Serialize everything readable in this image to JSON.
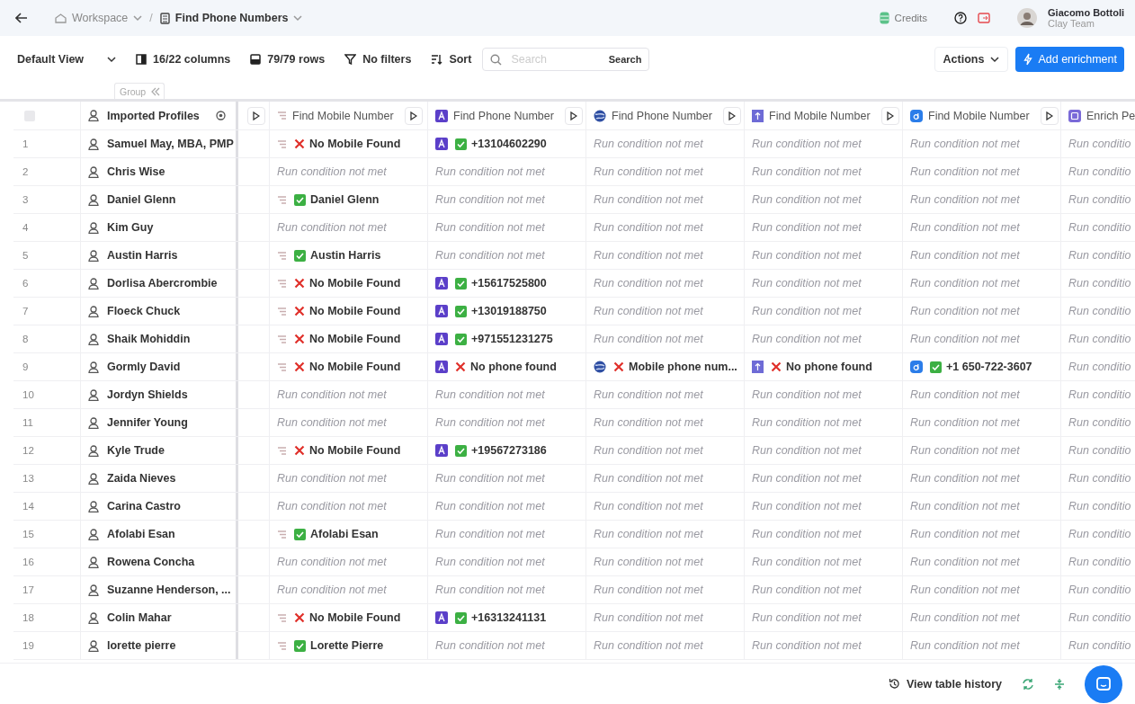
{
  "topbar": {
    "workspace": "Workspace",
    "separator": "/",
    "table_name": "Find Phone Numbers",
    "credits": "Credits",
    "user_name": "Giacomo Bottoli",
    "team": "Clay Team"
  },
  "toolbar": {
    "view": "Default View",
    "columns": "16/22 columns",
    "rows": "79/79 rows",
    "filters": "No filters",
    "sort": "Sort",
    "search": {
      "placeholder": "Search",
      "button": "Search"
    },
    "actions": "Actions",
    "add": "Add enrichment"
  },
  "group_tab": "Group",
  "table": {
    "select_all": {
      "checked": false
    },
    "profile_column": "Imported Profiles",
    "columns": [
      {
        "label": "Find Mobile Number"
      },
      {
        "label": "Find Phone Number"
      },
      {
        "label": "Find Phone Number"
      },
      {
        "label": "Find Mobile Number"
      },
      {
        "label": "Find Mobile Number"
      },
      {
        "label": "Enrich Pe"
      }
    ],
    "rows": [
      {
        "number": "1",
        "name": "Samuel May, MBA, PMP",
        "cells": [
          {
            "kind": "not_found",
            "text": "No Mobile Found"
          },
          {
            "kind": "found",
            "text": "+13104602290"
          },
          {
            "kind": "not_met",
            "text": "Run condition not met"
          },
          {
            "kind": "not_met",
            "text": "Run condition not met"
          },
          {
            "kind": "not_met",
            "text": "Run condition not met"
          },
          {
            "kind": "not_met",
            "text": "Run conditio"
          }
        ]
      },
      {
        "number": "2",
        "name": "Chris Wise",
        "cells": [
          {
            "kind": "not_met",
            "text": "Run condition not met"
          },
          {
            "kind": "not_met",
            "text": "Run condition not met"
          },
          {
            "kind": "not_met",
            "text": "Run condition not met"
          },
          {
            "kind": "not_met",
            "text": "Run condition not met"
          },
          {
            "kind": "not_met",
            "text": "Run condition not met"
          },
          {
            "kind": "not_met",
            "text": "Run conditio"
          }
        ]
      },
      {
        "number": "3",
        "name": "Daniel Glenn",
        "cells": [
          {
            "kind": "found",
            "text": "Daniel Glenn"
          },
          {
            "kind": "not_met",
            "text": "Run condition not met"
          },
          {
            "kind": "not_met",
            "text": "Run condition not met"
          },
          {
            "kind": "not_met",
            "text": "Run condition not met"
          },
          {
            "kind": "not_met",
            "text": "Run condition not met"
          },
          {
            "kind": "not_met",
            "text": "Run conditio"
          }
        ]
      },
      {
        "number": "4",
        "name": "Kim Guy",
        "cells": [
          {
            "kind": "not_met",
            "text": "Run condition not met"
          },
          {
            "kind": "not_met",
            "text": "Run condition not met"
          },
          {
            "kind": "not_met",
            "text": "Run condition not met"
          },
          {
            "kind": "not_met",
            "text": "Run condition not met"
          },
          {
            "kind": "not_met",
            "text": "Run condition not met"
          },
          {
            "kind": "not_met",
            "text": "Run conditio"
          }
        ]
      },
      {
        "number": "5",
        "name": "Austin Harris",
        "cells": [
          {
            "kind": "found",
            "text": "Austin Harris"
          },
          {
            "kind": "not_met",
            "text": "Run condition not met"
          },
          {
            "kind": "not_met",
            "text": "Run condition not met"
          },
          {
            "kind": "not_met",
            "text": "Run condition not met"
          },
          {
            "kind": "not_met",
            "text": "Run condition not met"
          },
          {
            "kind": "not_met",
            "text": "Run conditio"
          }
        ]
      },
      {
        "number": "6",
        "name": "Dorlisa Abercrombie",
        "cells": [
          {
            "kind": "not_found",
            "text": "No Mobile Found"
          },
          {
            "kind": "found",
            "text": "+15617525800"
          },
          {
            "kind": "not_met",
            "text": "Run condition not met"
          },
          {
            "kind": "not_met",
            "text": "Run condition not met"
          },
          {
            "kind": "not_met",
            "text": "Run condition not met"
          },
          {
            "kind": "not_met",
            "text": "Run conditio"
          }
        ]
      },
      {
        "number": "7",
        "name": "Floeck Chuck",
        "cells": [
          {
            "kind": "not_found",
            "text": "No Mobile Found"
          },
          {
            "kind": "found",
            "text": "+13019188750"
          },
          {
            "kind": "not_met",
            "text": "Run condition not met"
          },
          {
            "kind": "not_met",
            "text": "Run condition not met"
          },
          {
            "kind": "not_met",
            "text": "Run condition not met"
          },
          {
            "kind": "not_met",
            "text": "Run conditio"
          }
        ]
      },
      {
        "number": "8",
        "name": "Shaik Mohiddin",
        "cells": [
          {
            "kind": "not_found",
            "text": "No Mobile Found"
          },
          {
            "kind": "found",
            "text": "+971551231275"
          },
          {
            "kind": "not_met",
            "text": "Run condition not met"
          },
          {
            "kind": "not_met",
            "text": "Run condition not met"
          },
          {
            "kind": "not_met",
            "text": "Run condition not met"
          },
          {
            "kind": "not_met",
            "text": "Run conditio"
          }
        ]
      },
      {
        "number": "9",
        "name": "Gormly David",
        "cells": [
          {
            "kind": "not_found",
            "text": "No Mobile Found"
          },
          {
            "kind": "not_found",
            "text": "No phone found"
          },
          {
            "kind": "not_found",
            "text": "Mobile phone num..."
          },
          {
            "kind": "not_found",
            "text": "No phone found"
          },
          {
            "kind": "found",
            "text": "+1 650-722-3607"
          },
          {
            "kind": "not_met",
            "text": "Run conditio"
          }
        ]
      },
      {
        "number": "10",
        "name": "Jordyn Shields",
        "cells": [
          {
            "kind": "not_met",
            "text": "Run condition not met"
          },
          {
            "kind": "not_met",
            "text": "Run condition not met"
          },
          {
            "kind": "not_met",
            "text": "Run condition not met"
          },
          {
            "kind": "not_met",
            "text": "Run condition not met"
          },
          {
            "kind": "not_met",
            "text": "Run condition not met"
          },
          {
            "kind": "not_met",
            "text": "Run conditio"
          }
        ]
      },
      {
        "number": "11",
        "name": "Jennifer Young",
        "cells": [
          {
            "kind": "not_met",
            "text": "Run condition not met"
          },
          {
            "kind": "not_met",
            "text": "Run condition not met"
          },
          {
            "kind": "not_met",
            "text": "Run condition not met"
          },
          {
            "kind": "not_met",
            "text": "Run condition not met"
          },
          {
            "kind": "not_met",
            "text": "Run condition not met"
          },
          {
            "kind": "not_met",
            "text": "Run conditio"
          }
        ]
      },
      {
        "number": "12",
        "name": "Kyle Trude",
        "cells": [
          {
            "kind": "not_found",
            "text": "No Mobile Found"
          },
          {
            "kind": "found",
            "text": "+19567273186"
          },
          {
            "kind": "not_met",
            "text": "Run condition not met"
          },
          {
            "kind": "not_met",
            "text": "Run condition not met"
          },
          {
            "kind": "not_met",
            "text": "Run condition not met"
          },
          {
            "kind": "not_met",
            "text": "Run conditio"
          }
        ]
      },
      {
        "number": "13",
        "name": "Zaida Nieves",
        "cells": [
          {
            "kind": "not_met",
            "text": "Run condition not met"
          },
          {
            "kind": "not_met",
            "text": "Run condition not met"
          },
          {
            "kind": "not_met",
            "text": "Run condition not met"
          },
          {
            "kind": "not_met",
            "text": "Run condition not met"
          },
          {
            "kind": "not_met",
            "text": "Run condition not met"
          },
          {
            "kind": "not_met",
            "text": "Run conditio"
          }
        ]
      },
      {
        "number": "14",
        "name": "Carina Castro",
        "cells": [
          {
            "kind": "not_met",
            "text": "Run condition not met"
          },
          {
            "kind": "not_met",
            "text": "Run condition not met"
          },
          {
            "kind": "not_met",
            "text": "Run condition not met"
          },
          {
            "kind": "not_met",
            "text": "Run condition not met"
          },
          {
            "kind": "not_met",
            "text": "Run condition not met"
          },
          {
            "kind": "not_met",
            "text": "Run conditio"
          }
        ]
      },
      {
        "number": "15",
        "name": "Afolabi Esan",
        "cells": [
          {
            "kind": "found",
            "text": "Afolabi Esan"
          },
          {
            "kind": "not_met",
            "text": "Run condition not met"
          },
          {
            "kind": "not_met",
            "text": "Run condition not met"
          },
          {
            "kind": "not_met",
            "text": "Run condition not met"
          },
          {
            "kind": "not_met",
            "text": "Run condition not met"
          },
          {
            "kind": "not_met",
            "text": "Run conditio"
          }
        ]
      },
      {
        "number": "16",
        "name": "Rowena Concha",
        "cells": [
          {
            "kind": "not_met",
            "text": "Run condition not met"
          },
          {
            "kind": "not_met",
            "text": "Run condition not met"
          },
          {
            "kind": "not_met",
            "text": "Run condition not met"
          },
          {
            "kind": "not_met",
            "text": "Run condition not met"
          },
          {
            "kind": "not_met",
            "text": "Run condition not met"
          },
          {
            "kind": "not_met",
            "text": "Run conditio"
          }
        ]
      },
      {
        "number": "17",
        "name": "Suzanne Henderson, ...",
        "cells": [
          {
            "kind": "not_met",
            "text": "Run condition not met"
          },
          {
            "kind": "not_met",
            "text": "Run condition not met"
          },
          {
            "kind": "not_met",
            "text": "Run condition not met"
          },
          {
            "kind": "not_met",
            "text": "Run condition not met"
          },
          {
            "kind": "not_met",
            "text": "Run condition not met"
          },
          {
            "kind": "not_met",
            "text": "Run conditio"
          }
        ]
      },
      {
        "number": "18",
        "name": "Colin Mahar",
        "cells": [
          {
            "kind": "not_found",
            "text": "No Mobile Found"
          },
          {
            "kind": "found",
            "text": "+16313241131"
          },
          {
            "kind": "not_met",
            "text": "Run condition not met"
          },
          {
            "kind": "not_met",
            "text": "Run condition not met"
          },
          {
            "kind": "not_met",
            "text": "Run condition not met"
          },
          {
            "kind": "not_met",
            "text": "Run conditio"
          }
        ]
      },
      {
        "number": "19",
        "name": "lorette pierre",
        "cells": [
          {
            "kind": "found",
            "text": "Lorette Pierre"
          },
          {
            "kind": "not_met",
            "text": "Run condition not met"
          },
          {
            "kind": "not_met",
            "text": "Run condition not met"
          },
          {
            "kind": "not_met",
            "text": "Run condition not met"
          },
          {
            "kind": "not_met",
            "text": "Run condition not met"
          },
          {
            "kind": "not_met",
            "text": "Run conditio"
          }
        ]
      }
    ]
  },
  "footer": {
    "history": "View table history"
  }
}
